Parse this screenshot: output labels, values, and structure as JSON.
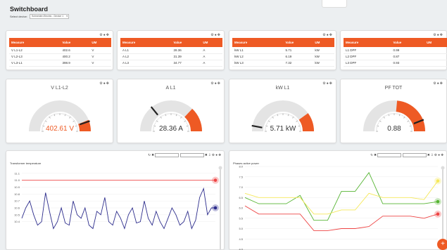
{
  "header": {
    "title": "Switchboard",
    "device_label": "Select device:",
    "device_value": "Schneider-Electric - Device 1"
  },
  "icons": {
    "settings": "gear-icon",
    "info": "info-icon",
    "move": "move-icon"
  },
  "tables": [
    {
      "headers": [
        "Measure",
        "Value",
        "UM"
      ],
      "rows": [
        [
          "V L1-L2",
          "402.6",
          "V"
        ],
        [
          "V L2-L3",
          "400.2",
          "V"
        ],
        [
          "V L3-L1",
          "398.9",
          "V"
        ]
      ]
    },
    {
      "headers": [
        "Measure",
        "Value",
        "UM"
      ],
      "rows": [
        [
          "A L1",
          "28.36",
          "A"
        ],
        [
          "A L2",
          "31.39",
          "A"
        ],
        [
          "A L3",
          "34.77",
          "A"
        ]
      ]
    },
    {
      "headers": [
        "Measure",
        "Value",
        "UM"
      ],
      "rows": [
        [
          "kW L1",
          "5.71",
          "kW"
        ],
        [
          "kW L2",
          "6.19",
          "kW"
        ],
        [
          "kW L3",
          "7.32",
          "kW"
        ]
      ]
    },
    {
      "headers": [
        "Measure",
        "Value",
        "UM"
      ],
      "rows": [
        [
          "L1 DPF",
          "0.99",
          ""
        ],
        [
          "L2 DPF",
          "0.87",
          ""
        ],
        [
          "L3 DPF",
          "0.93",
          ""
        ]
      ]
    }
  ],
  "gauges": [
    {
      "label": "V L1-L2",
      "display": "402.61 V",
      "value": 402.61,
      "min": 0,
      "max": 450,
      "band_from": 0.88,
      "value_color": "#ee5a24"
    },
    {
      "label": "A L1",
      "display": "28.36 A",
      "value": 28.36,
      "min": 0,
      "max": 100,
      "band_from": 0.74,
      "value_color": "#333333"
    },
    {
      "label": "kW L1",
      "display": "5.71 kW",
      "value": 5.71,
      "min": 0,
      "max": 100,
      "band_from": 0.8,
      "value_color": "#333333"
    },
    {
      "label": "PF TOT",
      "display": "0.88",
      "value": 0.88,
      "min": 0,
      "max": 1,
      "band_from": 0.53,
      "value_color": "#333333"
    }
  ],
  "colors": {
    "accent": "#ee5a24",
    "navy": "#2c2c8c",
    "red": "#ee4444",
    "green": "#55b432",
    "yellow": "#f5e85a"
  },
  "chart_data": [
    {
      "type": "line",
      "title": "Transformer temperature",
      "ylim": [
        10.0,
        11.2
      ],
      "y_ticks": [
        "11.1",
        "11.0",
        "10.9",
        "10.8",
        "10.7",
        "10.6",
        "10.5",
        "10.4"
      ],
      "series": [
        {
          "color": "#ee4444",
          "values": [
            11.0,
            11.0,
            11.0,
            11.0,
            11.0,
            11.0,
            11.0,
            11.0,
            11.0,
            11.0,
            11.0,
            11.0,
            11.0,
            11.0,
            11.0,
            11.0,
            11.0,
            11.0,
            11.0,
            11.0,
            11.0,
            11.0,
            11.0,
            11.0,
            11.0,
            11.0,
            11.0,
            11.0,
            11.0,
            11.0,
            11.0,
            11.0,
            11.0,
            11.0,
            11.0,
            11.0,
            11.0,
            11.0,
            11.0,
            11.0,
            11.0,
            11.0,
            11.0,
            11.0,
            11.0,
            11.0,
            11.0,
            11.0,
            11.0,
            11.0
          ]
        },
        {
          "color": "#2c2c8c",
          "values": [
            10.45,
            10.6,
            10.7,
            10.5,
            10.35,
            10.4,
            10.82,
            10.55,
            10.3,
            10.4,
            10.6,
            10.38,
            10.35,
            10.7,
            10.5,
            10.45,
            10.6,
            10.35,
            10.3,
            10.55,
            10.5,
            10.75,
            10.4,
            10.35,
            10.55,
            10.45,
            10.3,
            10.5,
            10.6,
            10.38,
            10.4,
            10.7,
            10.45,
            10.35,
            10.55,
            10.4,
            10.3,
            10.45,
            10.6,
            10.5,
            10.35,
            10.4,
            10.55,
            10.3,
            10.42,
            10.75,
            10.88,
            10.5,
            10.6,
            10.6
          ]
        }
      ]
    },
    {
      "type": "line",
      "title": "Phases active power",
      "ylim": [
        4.0,
        8.0
      ],
      "y_ticks": [
        "8.0",
        "7.5",
        "7.0",
        "6.5",
        "6.0",
        "5.5",
        "5.0",
        "4.5",
        "4.0"
      ],
      "series": [
        {
          "color": "#55b432",
          "values": [
            6.5,
            6.2,
            6.2,
            6.2,
            6.6,
            5.4,
            5.4,
            6.8,
            6.8,
            7.7,
            6.2,
            6.2,
            6.2,
            6.2,
            6.3
          ]
        },
        {
          "color": "#f5e85a",
          "values": [
            6.7,
            6.5,
            6.5,
            6.5,
            6.5,
            5.7,
            5.7,
            5.9,
            5.9,
            6.7,
            6.5,
            6.5,
            6.5,
            6.4,
            7.3
          ]
        },
        {
          "color": "#ee4444",
          "values": [
            6.1,
            5.7,
            5.7,
            5.7,
            5.7,
            4.9,
            4.9,
            5.0,
            5.0,
            5.1,
            5.6,
            5.6,
            5.6,
            5.5,
            5.7
          ]
        }
      ]
    }
  ]
}
